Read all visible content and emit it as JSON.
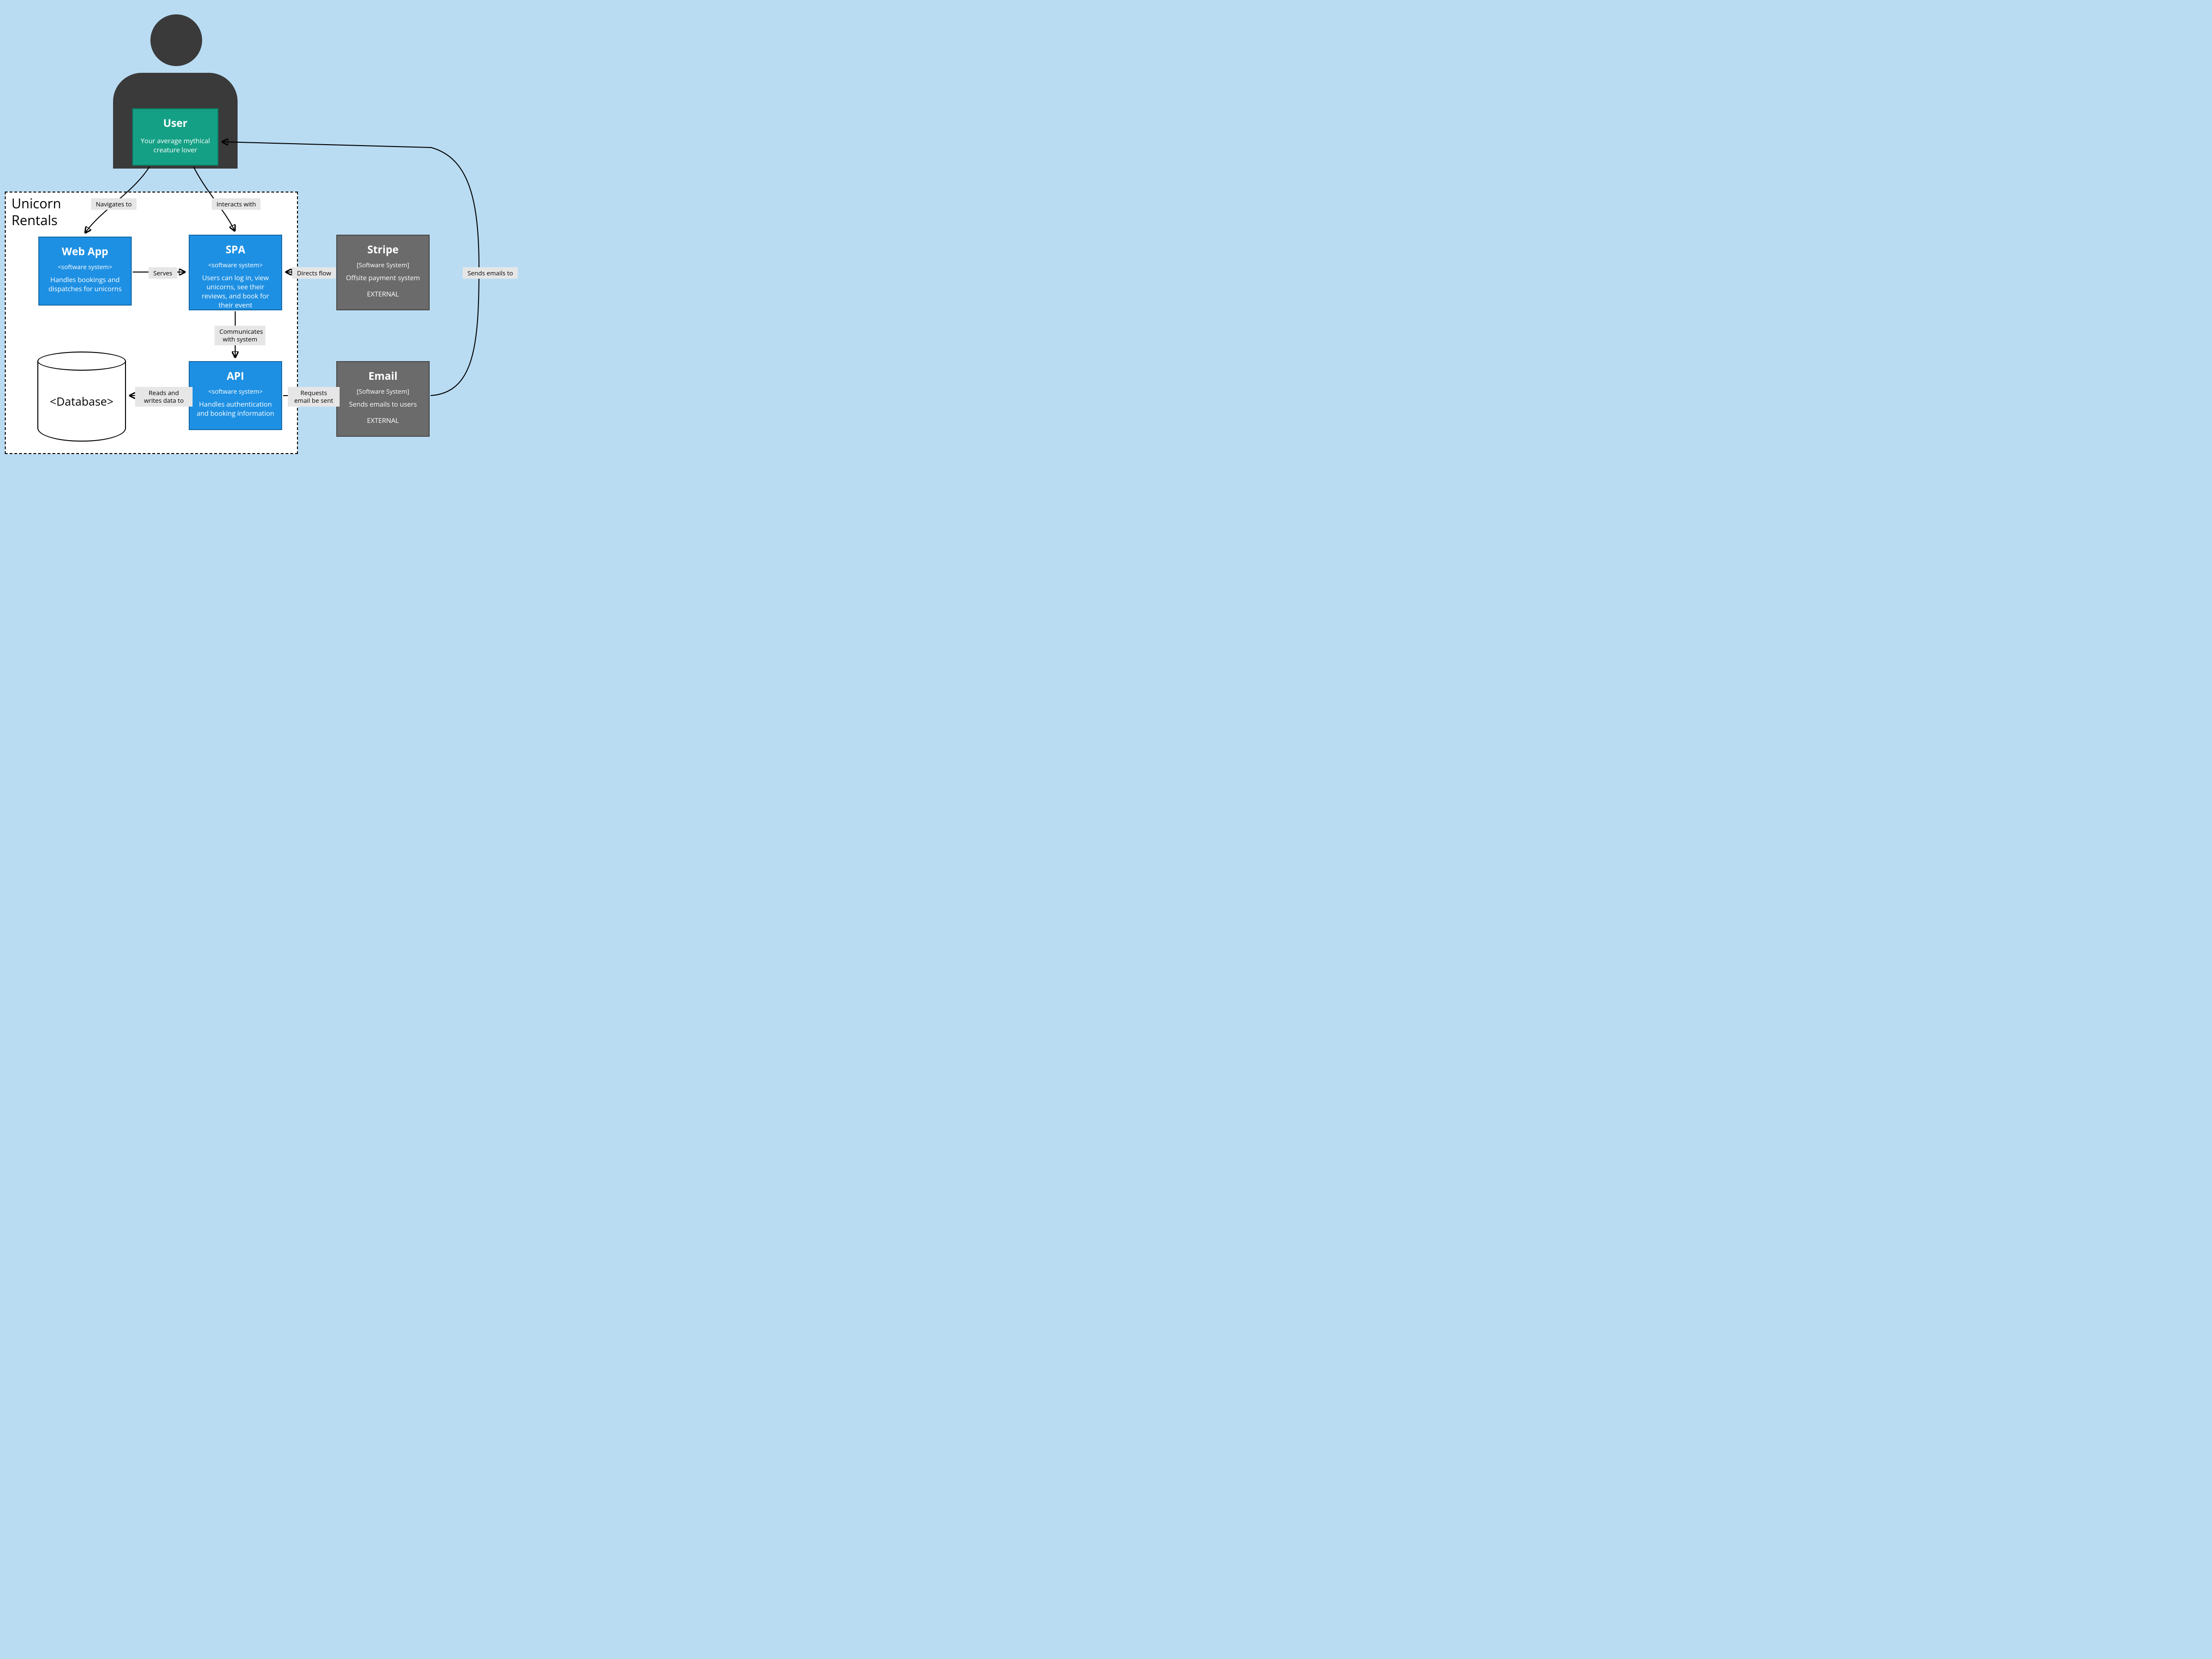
{
  "container": {
    "title_line1": "Unicorn",
    "title_line2": "Rentals"
  },
  "nodes": {
    "user": {
      "title": "User",
      "desc": "Your average mythical creature lover"
    },
    "webapp": {
      "title": "Web App",
      "subtitle": "<software system>",
      "desc": "Handles bookings and dispatches for unicorns"
    },
    "spa": {
      "title": "SPA",
      "subtitle": "<software system>",
      "desc": "Users can log in, view unicorns, see their reviews, and book for their event"
    },
    "api": {
      "title": "API",
      "subtitle": "<software system>",
      "desc": "Handles authentication and booking information"
    },
    "stripe": {
      "title": "Stripe",
      "subtitle": "[Software System]",
      "desc": "Offsite payment system",
      "tag": "EXTERNAL"
    },
    "email": {
      "title": "Email",
      "subtitle": "[Software System]",
      "desc": "Sends emails to users",
      "tag": "EXTERNAL"
    },
    "db": {
      "label": "<Database>"
    }
  },
  "edges": {
    "user_webapp": "Navigates to",
    "user_spa": "Interacts with",
    "webapp_spa": "Serves",
    "spa_stripe": "Directs flow",
    "spa_api": "Communicates with system",
    "api_db": "Reads and writes data to",
    "api_email": "Requests email be sent",
    "email_user": "Sends emails to"
  }
}
